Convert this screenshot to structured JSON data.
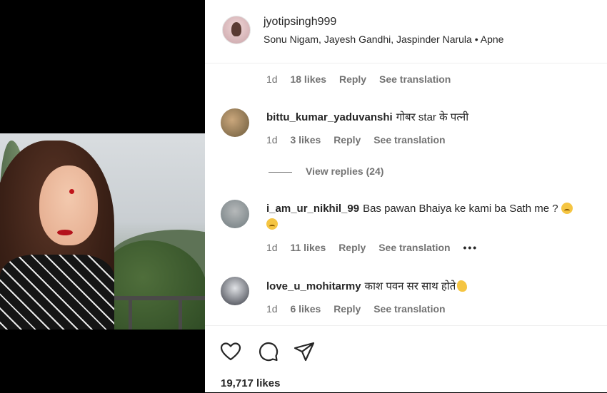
{
  "post": {
    "username": "jyotipsingh999",
    "audio": "Sonu Nigam, Jayesh Gandhi, Jaspinder Narula • Apne"
  },
  "comments": [
    {
      "username": "",
      "text": "",
      "time": "1d",
      "likes": "18 likes",
      "reply": "Reply",
      "translate": "See translation"
    },
    {
      "username": "bittu_kumar_yaduvanshi",
      "text": "गोबर star के पत्नी",
      "time": "1d",
      "likes": "3 likes",
      "reply": "Reply",
      "translate": "See translation",
      "view_replies": "View replies (24)"
    },
    {
      "username": "i_am_ur_nikhil_99",
      "text": "Bas pawan Bhaiya ke kami ba Sath me ?",
      "time": "1d",
      "likes": "11 likes",
      "reply": "Reply",
      "translate": "See translation",
      "more": "•••"
    },
    {
      "username": "love_u_mohitarmy",
      "text": "काश पवन सर साथ होते",
      "time": "1d",
      "likes": "6 likes",
      "reply": "Reply",
      "translate": "See translation"
    }
  ],
  "actions": {
    "like_icon": "heart-icon",
    "comment_icon": "comment-icon",
    "share_icon": "share-icon",
    "likes_total": "19,717 likes"
  }
}
